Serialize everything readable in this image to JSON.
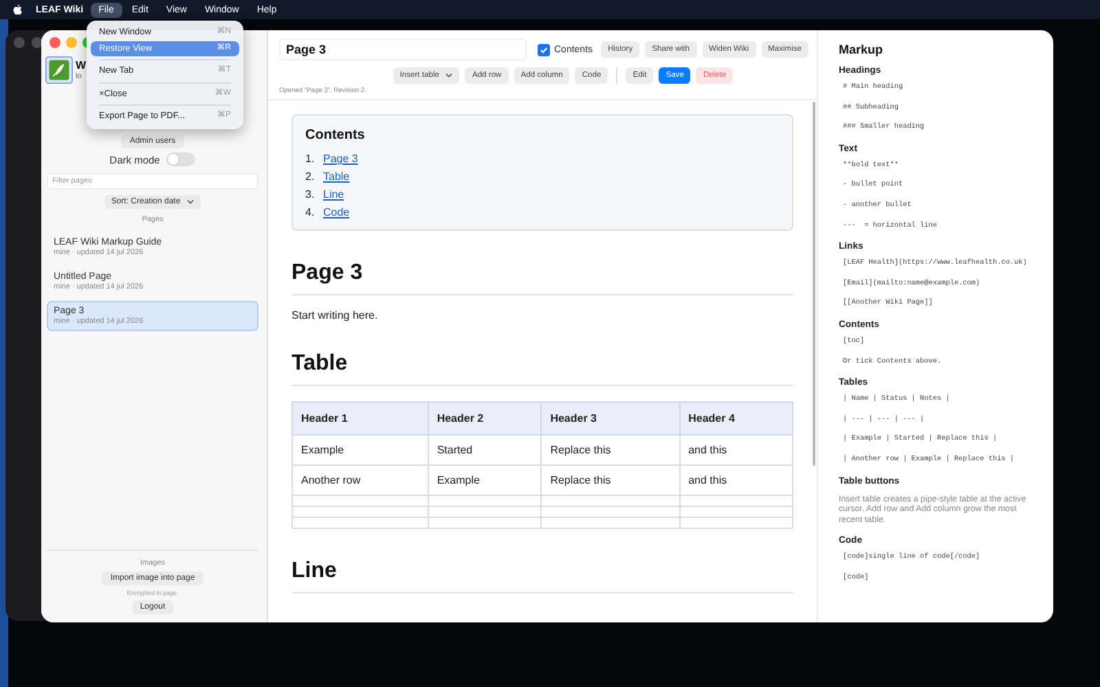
{
  "menubar": {
    "app_name": "LEAF Wiki",
    "menus": [
      {
        "label": "File",
        "selected": true
      },
      {
        "label": "Edit",
        "selected": false
      },
      {
        "label": "View",
        "selected": false
      },
      {
        "label": "Window",
        "selected": false
      },
      {
        "label": "Help",
        "selected": false
      }
    ]
  },
  "file_menu": {
    "groups": [
      [
        {
          "label": "New Window",
          "shortcut": "⌘N",
          "selected": false
        },
        {
          "label": "Restore View",
          "shortcut": "⌘R",
          "selected": true
        }
      ],
      [
        {
          "label": "New Tab",
          "shortcut": "⌘T",
          "selected": false
        }
      ],
      [
        {
          "prefix": "×",
          "label": "Close",
          "shortcut": "⌘W",
          "selected": false
        }
      ],
      [
        {
          "label": "Export Page to PDF...",
          "shortcut": "⌘P",
          "selected": false
        }
      ]
    ]
  },
  "sidebar": {
    "title": "W",
    "subtitle": "lo",
    "admin_button": "Admin users",
    "dark_mode": {
      "label": "Dark mode",
      "on": false
    },
    "filter": {
      "placeholder": "Filter pages"
    },
    "sort": "Sort: Creation date",
    "pages_heading": "Pages",
    "pages": [
      {
        "title": "LEAF Wiki Markup Guide",
        "meta": "mine · updated 14 jul 2026",
        "selected": false
      },
      {
        "title": "Untitled Page",
        "meta": "mine · updated 14 jul 2026",
        "selected": false
      },
      {
        "title": "Page 3",
        "meta": "mine · updated 14 jul 2026",
        "selected": true
      }
    ],
    "images_heading": "Images",
    "import_button": "Import image into page",
    "note": "Encrypted in page.",
    "logout": "Logout"
  },
  "editor": {
    "title_value": "Page 3",
    "contents_toggle": {
      "label": "Contents",
      "checked": true
    },
    "header_buttons": [
      "History",
      "Share with",
      "Widen Wiki",
      "Maximise"
    ],
    "toolbar": [
      {
        "label": "Insert table",
        "kind": "dropdown"
      },
      {
        "label": "Add row",
        "kind": "plain"
      },
      {
        "label": "Add column",
        "kind": "plain"
      },
      {
        "label": "Code",
        "kind": "plain"
      },
      {
        "kind": "divider"
      },
      {
        "label": "Edit",
        "kind": "plain"
      },
      {
        "label": "Save",
        "kind": "primary"
      },
      {
        "label": "Delete",
        "kind": "danger"
      }
    ],
    "status": "Opened \"Page 3\". Revision 2."
  },
  "preview": {
    "toc": {
      "title": "Contents",
      "items": [
        {
          "number": "1.",
          "label": "Page 3"
        },
        {
          "number": "2.",
          "label": "Table"
        },
        {
          "number": "3.",
          "label": "Line"
        },
        {
          "number": "4.",
          "label": "Code"
        }
      ]
    },
    "blocks": [
      {
        "kind": "heading",
        "text": "Page 3"
      },
      {
        "kind": "paragraph",
        "text": "Start writing here."
      },
      {
        "kind": "heading",
        "text": "Table"
      },
      {
        "kind": "table",
        "columns": [
          "Header 1",
          "Header 2",
          "Header 3",
          "Header 4"
        ],
        "rows": [
          {
            "cells": [
              "Example",
              "Started",
              "Replace this",
              "and this"
            ]
          },
          {
            "cells": [
              "Another row",
              "Example",
              "Replace this",
              "and this"
            ]
          },
          {
            "blank": true
          },
          {
            "blank": true
          },
          {
            "blank": true
          }
        ]
      },
      {
        "kind": "heading",
        "text": "Line"
      }
    ]
  },
  "markup": {
    "title": "Markup",
    "sections": [
      {
        "heading": "Headings",
        "items": [
          {
            "kind": "code",
            "text": "# Main heading"
          },
          {
            "kind": "code",
            "text": "## Subheading"
          },
          {
            "kind": "code",
            "text": "### Smaller heading"
          }
        ]
      },
      {
        "heading": "Text",
        "items": [
          {
            "kind": "code",
            "text": "**bold text**"
          },
          {
            "kind": "code",
            "text": "- bullet point"
          },
          {
            "kind": "code",
            "text": "- another bullet"
          },
          {
            "kind": "code",
            "text": "---  = horizontal line"
          }
        ]
      },
      {
        "heading": "Links",
        "items": [
          {
            "kind": "code",
            "text": "[LEAF Health](https://www.leafhealth.co.uk)"
          },
          {
            "kind": "code",
            "text": "[Email](mailto:name@example.com)"
          },
          {
            "kind": "code",
            "text": "[[Another Wiki Page]]"
          }
        ]
      },
      {
        "heading": "Contents",
        "items": [
          {
            "kind": "code",
            "text": "[toc]"
          },
          {
            "kind": "code",
            "text": "Or tick Contents above."
          }
        ]
      },
      {
        "heading": "Tables",
        "items": [
          {
            "kind": "code",
            "text": "| Name | Status | Notes |"
          },
          {
            "kind": "code",
            "text": "| --- | --- | --- |"
          },
          {
            "kind": "code",
            "text": "| Example | Started | Replace this |"
          },
          {
            "kind": "code",
            "text": "| Another row | Example | Replace this |"
          }
        ]
      },
      {
        "heading": "Table buttons",
        "items": [
          {
            "kind": "note",
            "text": "Insert table creates a pipe-style table at the active cursor. Add row and Add column grow the most recent table."
          }
        ]
      },
      {
        "heading": "Code",
        "items": [
          {
            "kind": "code",
            "text": "[code]single line of code[/code]"
          },
          {
            "kind": "code",
            "text": "[code]"
          }
        ]
      }
    ]
  }
}
